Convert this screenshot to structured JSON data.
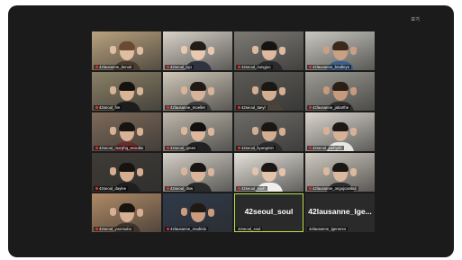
{
  "meeting": {
    "view_label": "보기",
    "tiles": [
      {
        "name": "42lausanne_benoit",
        "bg": "#b9a27e",
        "shirt": "#4a3b2f",
        "skin": "#e0bea4",
        "hair": "#6a4a30"
      },
      {
        "name": "42seoul_jsjo",
        "bg": "#d8d2c8",
        "shirt": "#2f3440",
        "skin": "#e8c9b0",
        "hair": "#231d19"
      },
      {
        "name": "42seoul_sungjoo",
        "bg": "#7d7a74",
        "shirt": "#2b2b2b",
        "skin": "#dcb9a0",
        "hair": "#161412"
      },
      {
        "name": "42lausanne_bradleys",
        "bg": "#c9c8c0",
        "shirt": "#3b5f8c",
        "skin": "#c9a084",
        "hair": "#3a2a1c"
      },
      {
        "name": "42seoul_fire",
        "bg": "#8a8066",
        "shirt": "#1d1d1d",
        "skin": "#d9b497",
        "hair": "#141210"
      },
      {
        "name": "42lausanne_rnoellet",
        "bg": "#cfc7b8",
        "shirt": "#3c3c3c",
        "skin": "#d7b39a",
        "hair": "#1f1a16"
      },
      {
        "name": "42seoul_taeyl",
        "bg": "#5b5a55",
        "shirt": "#4b4338",
        "skin": "#d4ae92",
        "hair": "#1a1714"
      },
      {
        "name": "42lausanne_jabarthe",
        "bg": "#9c9a93",
        "shirt": "#2f2f2f",
        "skin": "#c79a7c",
        "hair": "#2a1e16"
      },
      {
        "name": "42seoul_morphq_seoultw",
        "bg": "#7e6a5a",
        "shirt": "#6a2b2b",
        "skin": "#d8b295",
        "hair": "#161311"
      },
      {
        "name": "42seoul_green",
        "bg": "#bdb7ab",
        "shirt": "#222222",
        "skin": "#dcb79c",
        "hair": "#13110f"
      },
      {
        "name": "42seoul_kyungmin",
        "bg": "#6e6c68",
        "shirt": "#2c2c2c",
        "skin": "#d1ad91",
        "hair": "#191614"
      },
      {
        "name": "42seoul_jaehyeh",
        "bg": "#d9d5cc",
        "shirt": "#e8e6e1",
        "skin": "#d6b196",
        "hair": "#1b1815"
      },
      {
        "name": "42seoul_daylee",
        "bg": "#3f3b36",
        "shirt": "#1f1f1f",
        "skin": "#d5ae92",
        "hair": "#15120f"
      },
      {
        "name": "42seoul_dsw",
        "bg": "#d4cfc6",
        "shirt": "#2a2a2a",
        "skin": "#d9b59b",
        "hair": "#181513"
      },
      {
        "name": "42seoul_sooh",
        "bg": "#e5e1da",
        "shirt": "#f0efec",
        "skin": "#e3c3aa",
        "hair": "#1a1614"
      },
      {
        "name": "42lausanne_ongojcanikul",
        "bg": "#cfc9bf",
        "shirt": "#2e2e2e",
        "skin": "#dbb89e",
        "hair": "#1a1613"
      },
      {
        "name": "42seoul_yoonsubo",
        "bg": "#b08a66",
        "shirt": "#3d342c",
        "skin": "#d7b094",
        "hair": "#17130f"
      },
      {
        "name": "42lausanne_madrido",
        "bg": "#2f3a4a",
        "shirt": "#2a2f37",
        "skin": "#c99c7e",
        "hair": "#201813"
      }
    ],
    "name_tiles": [
      {
        "label": "42seoul_soul",
        "caption": "42seoul_soul"
      },
      {
        "label": "42lausanne_lge...",
        "caption": "42lausanne_lgeneres"
      }
    ]
  }
}
